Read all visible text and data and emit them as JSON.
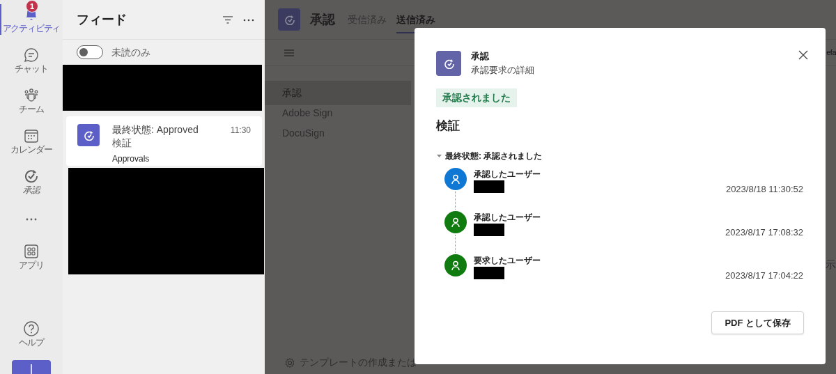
{
  "rail": {
    "items": [
      {
        "kind": "activity",
        "label": "アクティビティ",
        "selected": true,
        "badge": "1"
      },
      {
        "kind": "chat",
        "label": "チャット",
        "selected": false
      },
      {
        "kind": "teams",
        "label": "チーム",
        "selected": false
      },
      {
        "kind": "calendar",
        "label": "カレンダー",
        "selected": false
      },
      {
        "kind": "approvals",
        "label": "承認",
        "selected": false
      },
      {
        "kind": "more",
        "selected": false
      },
      {
        "kind": "apps",
        "label": "アプリ",
        "selected": false
      }
    ],
    "help": {
      "label": "ヘルプ"
    }
  },
  "feed": {
    "title": "フィード",
    "toggle": {
      "label": "未読のみ",
      "on": false
    },
    "items": [
      {
        "kind": "redacted"
      },
      {
        "kind": "notification",
        "title": "最終状態: Approved",
        "subtitle": "検証",
        "source": "Approvals",
        "time": "11:30"
      },
      {
        "kind": "redacted"
      }
    ]
  },
  "main": {
    "app_title": "承認",
    "tabs": [
      {
        "label": "受信済み",
        "selected": false
      },
      {
        "label": "送信済み",
        "selected": true
      }
    ],
    "toolbar_edge_text": "efa",
    "sidebar": {
      "items": [
        {
          "label": "承認",
          "selected": true
        },
        {
          "label": "Adobe Sign",
          "selected": false
        },
        {
          "label": "DocuSign",
          "selected": false
        }
      ]
    },
    "content_edge_text": "示",
    "footer_link": "テンプレートの作成または"
  },
  "modal": {
    "title": "承認",
    "subtitle": "承認要求の詳細",
    "status": "承認されました",
    "heading": "検証",
    "section": {
      "label": "最終状態: 承認されました",
      "expanded": true
    },
    "entries": [
      {
        "role": "承認したユーザー",
        "time": "2023/8/18 11:30:52",
        "color": "#0f78d4"
      },
      {
        "role": "承認したユーザー",
        "time": "2023/8/17 17:08:32",
        "color": "#107c10"
      },
      {
        "role": "要求したユーザー",
        "time": "2023/8/17 17:04:22",
        "color": "#107c10"
      }
    ],
    "button": "PDF として保存"
  }
}
